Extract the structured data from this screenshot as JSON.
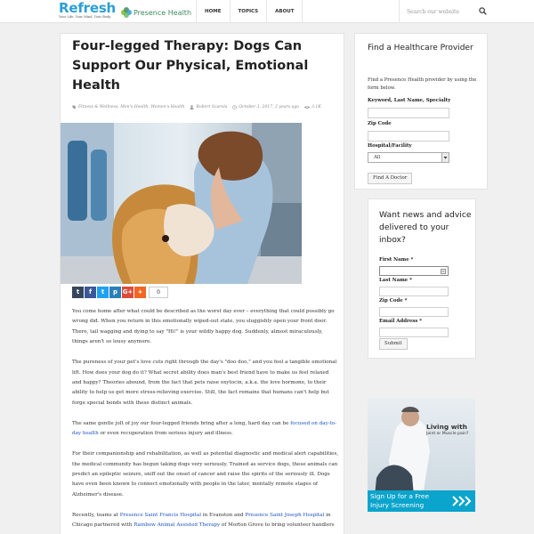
{
  "header": {
    "logo_text": "Refresh",
    "logo_tagline": "Your Life. Your Mind. Your Body.",
    "partner_text": "Presence Health",
    "nav": [
      "HOME",
      "TOPICS",
      "ABOUT"
    ],
    "search_placeholder": "Search our website"
  },
  "article": {
    "title": "Four-legged Therapy: Dogs Can Support Our Physical, Emotional Health",
    "categories": [
      "Fitness & Wellness",
      "Men's Health",
      "Women's Health"
    ],
    "author": "Robert Scarola",
    "date": "October 3, 2017, 2 years ago",
    "views": "3.1K",
    "share_count": "0",
    "share_buttons": [
      "t",
      "f",
      "t",
      "p",
      "G+",
      "+"
    ],
    "colors": {
      "tumblr": "#36465d",
      "facebook": "#3b5998",
      "twitter": "#1da1f2",
      "print": "#2a7fb8",
      "google": "#dd4b39",
      "more": "#f26522",
      "link": "#1a52c8"
    },
    "p1": "You come home after what could be described as the worst day ever – everything that could possibly go wrong did. When you return in this emotionally wiped-out state, you sluggishly open your front door. There, tail wagging and dying to say \"Hi!\" is your wildly happy dog. Suddenly, almost miraculously, things aren't so lousy anymore.",
    "p2": "The pureness of your pet's love cuts right through the day's \"doo doo,\" and you feel a tangible emotional lift. How does your dog do it? What secret ability does man's best friend have to make us feel relaxed and happy? Theories abound, from the fact that pets raise oxytocin, a.k.a. the love hormone, to their ability to help us get more stress-relieving exercise. Still, the fact remains that humans can't help but forge special bonds with these distinct animals.",
    "p3_a": "The same gentle jolt of joy our four-legged friends bring after a long, hard day can be ",
    "p3_link": "focused on day-to-day health",
    "p3_b": " or even recuperation from serious injury and illness.",
    "p4": "For their companionship and rehabilitation, as well as potential diagnostic and medical alert capabilities, the medical community has begun taking dogs very seriously. Trained as service dogs, these animals can predict an epileptic seizure, sniff out the onset of cancer and raise the spirits of the seriously ill. Dogs have even been known to connect emotionally with people in the later, mentally remote stages of Alzheimer's disease.",
    "p5_a": "Recently, teams at ",
    "p5_link1": "Presence Saint Francis Hospital",
    "p5_b": " in Evanston and ",
    "p5_link2": "Presence Saint Joseph Hospital",
    "p5_c": " in Chicago partnered with ",
    "p5_link3": "Rainbow Animal Assisted Therapy",
    "p5_d": " of Morton Grove to bring volunteer handlers"
  },
  "sidebar": {
    "provider": {
      "heading": "Find a Healthcare Provider",
      "intro": "Find a Presence Health provider by using the form below.",
      "label_keyword": "Keyword, Last Name, Specialty",
      "label_zip": "Zip Code",
      "label_hospital": "Hospital/Facility",
      "select_value": "All",
      "button": "Find A Doctor"
    },
    "newsletter": {
      "heading": "Want news and advice delivered to your inbox?",
      "label_first": "First Name *",
      "label_last": "Last Name *",
      "label_zip": "Zip Code *",
      "label_email": "Email Address *",
      "button": "Submit"
    },
    "ad": {
      "line1": "Living with",
      "line2": "Joint or Muscle pain?",
      "cta1": "Sign Up for a Free",
      "cta2": "Injury Screening"
    }
  }
}
